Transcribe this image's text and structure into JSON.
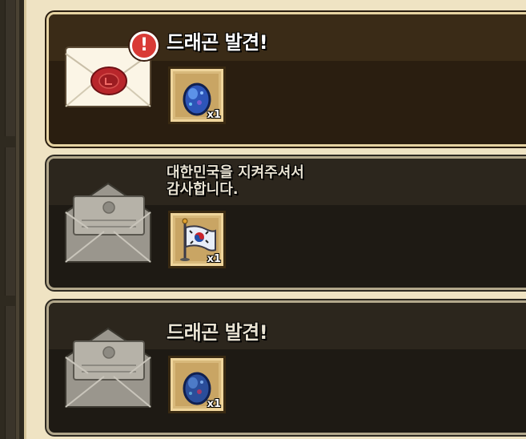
{
  "mails": [
    {
      "state": "new",
      "title": "드래곤 발견!",
      "badge": "!",
      "item": {
        "icon": "dragon-egg-icon",
        "qty": "x1"
      }
    },
    {
      "state": "read",
      "title": "대한민국을 지켜주셔서\n감사합니다.",
      "item": {
        "icon": "korean-flag-icon",
        "qty": "x1"
      }
    },
    {
      "state": "read",
      "title": "드래곤 발견!",
      "item": {
        "icon": "dragon-egg-icon",
        "qty": "x1"
      }
    }
  ],
  "colors": {
    "panel": "#efe3c3",
    "badge": "#d93a36",
    "wax_seal": "#b8262b",
    "egg": "#3d6fd0"
  }
}
